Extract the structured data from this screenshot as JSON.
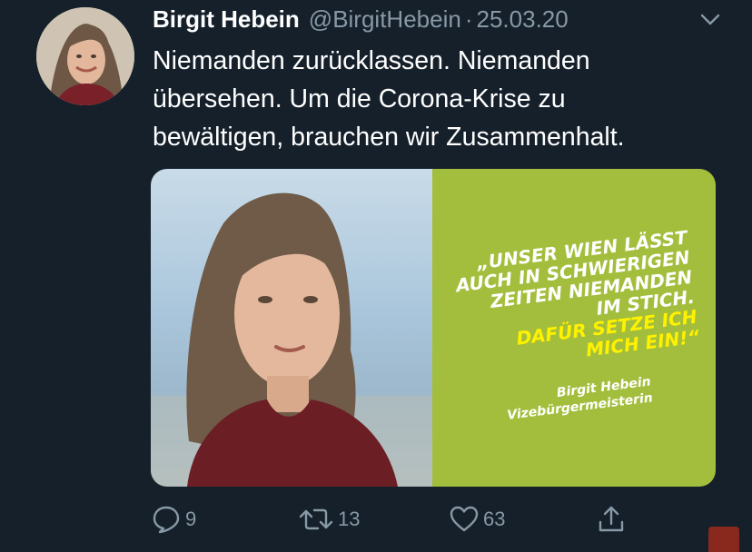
{
  "author": {
    "display_name": "Birgit Hebein",
    "handle": "@BirgitHebein",
    "separator": "·",
    "date": "25.03.20",
    "avatar_icon": "profile-photo"
  },
  "tweet": {
    "text_lines": [
      "Niemanden zurücklassen. Niemanden",
      "übersehen. Um die Corona-Krise zu",
      "bewältigen, brauchen wir Zusammenhalt."
    ]
  },
  "media": {
    "quote_lines": [
      "„UNSER WIEN LÄSST",
      "AUCH IN SCHWIERIGEN",
      "ZEITEN NIEMANDEN",
      "IM STICH."
    ],
    "quote_highlight_lines": [
      "DAFÜR SETZE ICH",
      "MICH EIN!“"
    ],
    "signature_name": "Birgit Hebein",
    "signature_title": "Vizebürgermeisterin",
    "panel_color": "#a3be3c",
    "highlight_color": "#fff200"
  },
  "actions": {
    "replies": "9",
    "retweets": "13",
    "likes": "63",
    "icons": [
      "reply-icon",
      "retweet-icon",
      "like-icon",
      "share-icon"
    ]
  },
  "theme": {
    "background": "#15202b",
    "secondary_text": "#8899a6"
  }
}
